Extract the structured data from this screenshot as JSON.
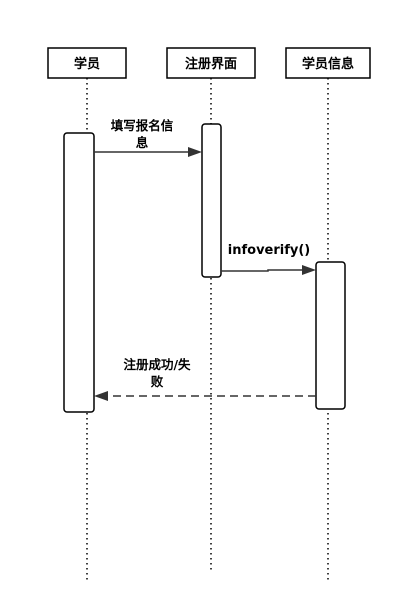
{
  "participants": [
    {
      "id": "student",
      "label": "学员"
    },
    {
      "id": "register_ui",
      "label": "注册界面"
    },
    {
      "id": "student_info",
      "label": "学员信息"
    }
  ],
  "messages": [
    {
      "id": "fill_info",
      "from": "student",
      "to": "register_ui",
      "kind": "sync",
      "label_lines": [
        "填写报名信",
        "息"
      ]
    },
    {
      "id": "infoverify",
      "from": "register_ui",
      "to": "student_info",
      "kind": "sync",
      "label_lines": [
        "infoverify()"
      ]
    },
    {
      "id": "register_result",
      "from": "student_info",
      "to": "student",
      "kind": "return",
      "label_lines": [
        "注册成功/失",
        "败"
      ]
    }
  ]
}
